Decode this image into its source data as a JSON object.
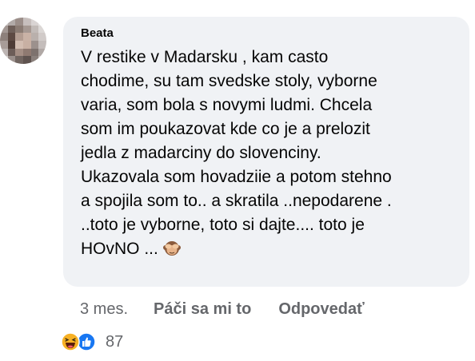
{
  "comment": {
    "author": "Beata",
    "text": "V restike v Madarsku , kam casto\nchodime, su tam svedske stoly, vyborne\nvaria,  som bola s novymi ludmi. Chcela\nsom im poukazovat kde co je a prelozit\njedla z madarciny do slovenciny.\nUkazovala som hovadziie a potom stehno\na spojila som to.. a skratila ..nepodarene .\n..toto je vyborne, toto si dajte....  toto je\nHOvNO ...",
    "trailing_emoji": "see-no-evil-monkey-icon"
  },
  "actions": {
    "time": "3 mes.",
    "like_label": "Páči sa mi to",
    "reply_label": "Odpovedať"
  },
  "reactions": {
    "icons": [
      "haha-icon",
      "like-icon"
    ],
    "count": "87"
  },
  "colors": {
    "bubble_bg": "#f0f2f5",
    "text": "#050505",
    "secondary_text": "#65676b",
    "like_blue": "#1877f2",
    "haha_yellow": "#f7b125"
  }
}
